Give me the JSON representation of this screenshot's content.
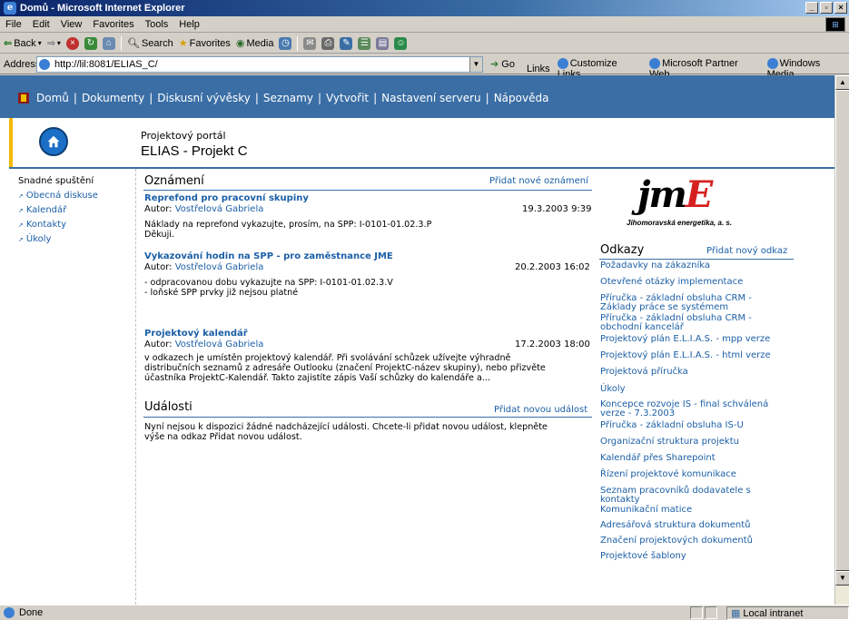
{
  "window": {
    "title": "Domů - Microsoft Internet Explorer"
  },
  "menu": [
    "File",
    "Edit",
    "View",
    "Favorites",
    "Tools",
    "Help"
  ],
  "toolbar": {
    "back": "Back",
    "search": "Search",
    "favorites": "Favorites",
    "media": "Media"
  },
  "address": {
    "label": "Address",
    "url": "http://lil:8081/ELIAS_C/",
    "go": "Go",
    "links_label": "Links",
    "links": [
      "Customize Links",
      "Microsoft Partner Web",
      "Windows Media"
    ]
  },
  "topnav": {
    "items": [
      "Domů",
      "Dokumenty",
      "Diskusní vývěsky",
      "Seznamy",
      "Vytvořit",
      "Nastavení serveru",
      "Nápověda"
    ]
  },
  "header": {
    "subtitle": "Projektový portál",
    "title": "ELIAS - Projekt C"
  },
  "leftnav": {
    "heading": "Snadné spuštění",
    "items": [
      "Obecná diskuse",
      "Kalendář",
      "Kontakty",
      "Úkoly"
    ]
  },
  "announcements": {
    "title": "Oznámení",
    "add_link": "Přidat nové oznámení",
    "author_label": "Autor:",
    "items": [
      {
        "title": "Reprefond pro pracovní skupiny",
        "author": "Vostřelová Gabriela",
        "date": "19.3.2003 9:39",
        "body": [
          "Náklady na reprefond vykazujte, prosím, na SPP: I-0101-01.02.3.P",
          "Děkuji."
        ]
      },
      {
        "title": "Vykazování hodin na SPP - pro zaměstnance JME",
        "author": "Vostřelová Gabriela",
        "date": "20.2.2003 16:02",
        "body": [
          "- odpracovanou dobu vykazujte na SPP: I-0101-01.02.3.V",
          "- loňské SPP prvky již nejsou platné"
        ]
      },
      {
        "title": "Projektový kalendář",
        "author": "Vostřelová Gabriela",
        "date": "17.2.2003 18:00",
        "body": [
          "v odkazech je umístěn projektový kalendář. Při svolávání schůzek užívejte výhradně",
          "distribučních seznamů z adresáře Outlooku (značení ProjektC-název skupiny), nebo přizvěte",
          "účastníka ProjektC-Kalendář. Takto zajistíte zápis Vaší schůzky do kalendáře a..."
        ]
      }
    ]
  },
  "events": {
    "title": "Události",
    "add_link": "Přidat novou událost",
    "body": [
      "Nyní nejsou k dispozici žádné nadcházející události. Chcete-li přidat novou událost, klepněte",
      "výše na odkaz Přidat novou událost."
    ]
  },
  "logo": {
    "mark_j": "jm",
    "mark_e": "E",
    "caption": "Jihomoravská energetika, a. s."
  },
  "links_section": {
    "title": "Odkazy",
    "add_link": "Přidat nový odkaz",
    "items": [
      [
        "Požadavky na zákazníka"
      ],
      [
        "Otevřené otázky implementace"
      ],
      [
        "Příručka - základní obsluha CRM -",
        "Základy práce se systémem"
      ],
      [
        "Příručka - základní obsluha CRM -",
        "obchodní kancelář"
      ],
      [
        "Projektový plán E.L.I.A.S. - mpp verze"
      ],
      [
        "Projektový plán E.L.I.A.S. - html verze"
      ],
      [
        "Projektová příručka"
      ],
      [
        "Úkoly"
      ],
      [
        "Koncepce rozvoje IS - final schválená",
        "verze - 7.3.2003"
      ],
      [
        "Příručka - základní obsluha IS-U"
      ],
      [
        "Organizační struktura projektu"
      ],
      [
        "Kalendář přes Sharepoint"
      ],
      [
        "Řízení projektové komunikace"
      ],
      [
        "Seznam pracovníků dodavatele s",
        "kontakty"
      ],
      [
        "Komunikační matice"
      ],
      [
        "Adresářová struktura dokumentů"
      ],
      [
        "Značení projektových dokumentů"
      ],
      [
        "Projektové šablony"
      ]
    ]
  },
  "status": {
    "text": "Done",
    "zone": "Local intranet"
  }
}
